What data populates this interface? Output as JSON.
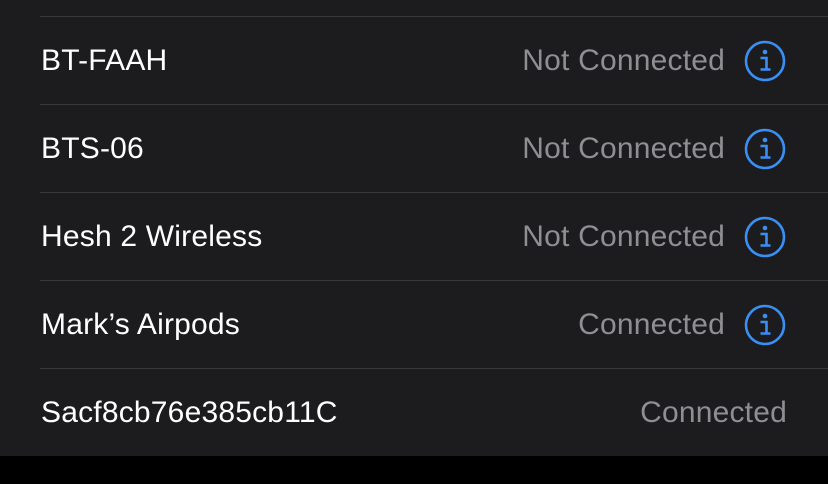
{
  "accent_color": "#3a8ff5",
  "devices": [
    {
      "name": "BT-FAAH",
      "status": "Not Connected",
      "info_icon": "info-circle-icon"
    },
    {
      "name": "BTS-06",
      "status": "Not Connected",
      "info_icon": "info-circle-icon"
    },
    {
      "name": "Hesh 2 Wireless",
      "status": "Not Connected",
      "info_icon": "info-circle-icon"
    },
    {
      "name": "Mark’s Airpods",
      "status": "Connected",
      "info_icon": "info-circle-icon"
    },
    {
      "name": "Sacf8cb76e385cb11C",
      "status": "Connected"
    }
  ]
}
